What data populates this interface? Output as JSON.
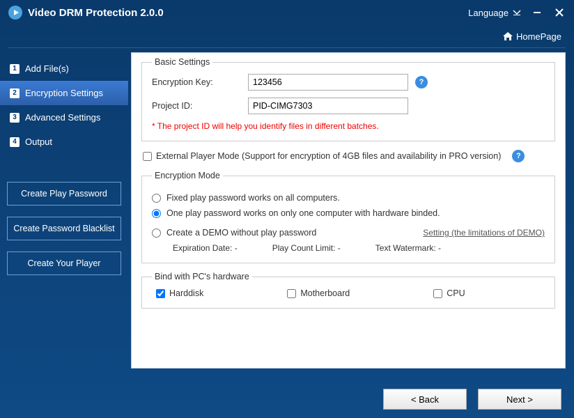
{
  "app": {
    "title": "Video DRM Protection 2.0.0"
  },
  "titlebar": {
    "language": "Language"
  },
  "homepage": {
    "label": "HomePage"
  },
  "nav": {
    "items": [
      {
        "num": "1",
        "label": "Add File(s)"
      },
      {
        "num": "2",
        "label": "Encryption Settings"
      },
      {
        "num": "3",
        "label": "Advanced Settings"
      },
      {
        "num": "4",
        "label": "Output"
      }
    ]
  },
  "sidebuttons": {
    "play_password": "Create Play Password",
    "blacklist": "Create Password Blacklist",
    "player": "Create Your Player"
  },
  "basic": {
    "legend": "Basic Settings",
    "enc_key_label": "Encryption Key:",
    "enc_key_value": "123456",
    "project_id_label": "Project ID:",
    "project_id_value": "PID-CIMG7303",
    "note": "* The project ID will help you identify files in different batches."
  },
  "external": {
    "label": "External Player Mode (Support for encryption of 4GB files and availability in PRO version)"
  },
  "mode": {
    "legend": "Encryption Mode",
    "opt_fixed": "Fixed play password works on all computers.",
    "opt_one": "One play password works on only one computer with hardware binded.",
    "opt_demo": "Create a DEMO without play password",
    "demo_link": "Setting (the limitations of DEMO)",
    "exp_label": "Expiration Date: -",
    "play_count_label": "Play Count Limit: -",
    "watermark_label": "Text Watermark: -"
  },
  "hw": {
    "legend": "Bind with PC's hardware",
    "harddisk": "Harddisk",
    "motherboard": "Motherboard",
    "cpu": "CPU"
  },
  "footer": {
    "back": "<  Back",
    "next": "Next  >"
  },
  "help_q": "?"
}
